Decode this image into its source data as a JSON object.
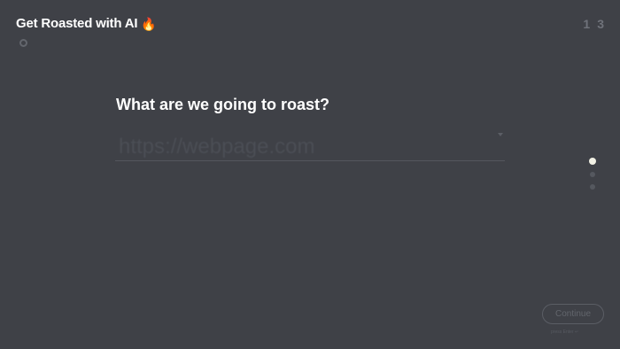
{
  "header": {
    "title": "Get Roasted with AI",
    "title_emoji": "🔥",
    "settings_icon": "gear-icon"
  },
  "steps": {
    "current": "1",
    "total": "3"
  },
  "question": {
    "text": "What are we going to roast?"
  },
  "url_field": {
    "value": "",
    "placeholder": "https://webpage.com"
  },
  "pager": {
    "count": 3,
    "active_index": 0
  },
  "footer": {
    "continue_label": "Continue",
    "hint": "press Enter ↵"
  },
  "colors": {
    "background": "#3f4147",
    "text": "#ffffff",
    "active_dot": "#f1f0e4"
  }
}
